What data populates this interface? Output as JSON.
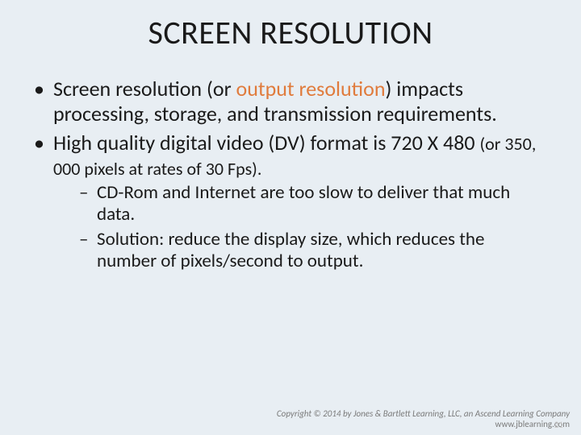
{
  "title": "SCREEN RESOLUTION",
  "bullets": {
    "b1_pre": "Screen resolution (or ",
    "b1_accent": "output resolution",
    "b1_post": ") impacts processing, storage, and transmission requirements.",
    "b2_main": "High quality digital video (DV) format is 720 X 480 ",
    "b2_small": "(or 350, 000 pixels at rates of 30 Fps).",
    "sub1": "CD-Rom and Internet are too slow to deliver that much data.",
    "sub2": "Solution: reduce the display size, which reduces the number of pixels/second to output."
  },
  "footer": {
    "copyright": "Copyright © 2014 by Jones & Bartlett Learning, LLC, an Ascend Learning Company",
    "url": "www.jblearning.com"
  },
  "page": "21"
}
